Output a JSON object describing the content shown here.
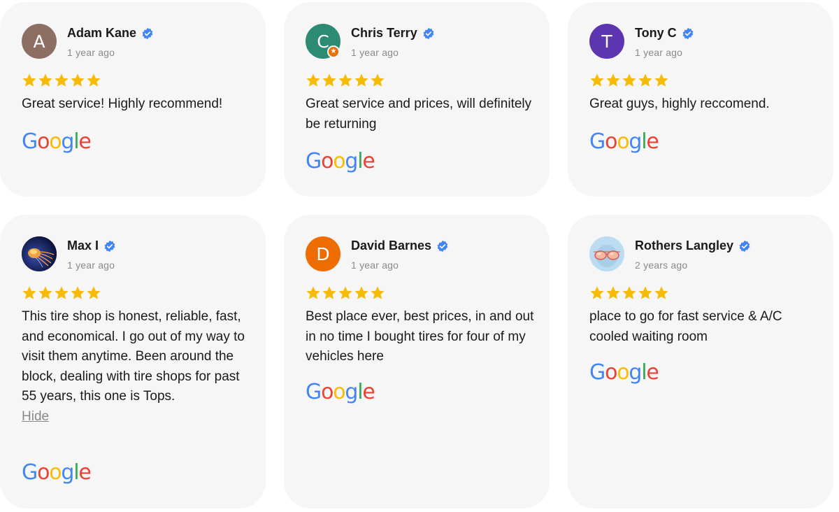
{
  "colors": {
    "card_bg": "#f6f6f6",
    "star": "#f6bb06",
    "verified": "#4285f4",
    "google_blue": "#4285f4",
    "google_red": "#ea4335",
    "google_yellow": "#fbbc05",
    "google_green": "#34a853"
  },
  "google_logo": {
    "letters": [
      "G",
      "o",
      "o",
      "g",
      "l",
      "e"
    ],
    "icon": "google-logo"
  },
  "reviews": [
    {
      "name": "Adam Kane",
      "avatar_letter": "A",
      "avatar_color": "#8d6e63",
      "verified": true,
      "date": "1 year ago",
      "rating": 5,
      "text": "Great service! Highly recommend!"
    },
    {
      "name": "Chris Terry",
      "avatar_letter": "C",
      "avatar_color": "#2e8b73",
      "avatar_badge": "local-guide-badge-icon",
      "verified": true,
      "date": "1 year ago",
      "rating": 5,
      "text": "Great service and prices, will definitely be returning"
    },
    {
      "name": "Tony C",
      "avatar_letter": "T",
      "avatar_color": "#5e35b1",
      "verified": true,
      "date": "1 year ago",
      "rating": 5,
      "text": "Great guys, highly reccomend."
    },
    {
      "name": "Max I",
      "avatar_letter": "",
      "avatar_image": "jellyfish-photo",
      "verified": true,
      "date": "1 year ago",
      "rating": 5,
      "text": "This tire shop is honest, reliable, fast, and economical. I go out of my way to visit them anytime. Been around the block, dealing with tire shops for past 55 years, this one is Tops.",
      "hide_label": "Hide"
    },
    {
      "name": "David Barnes",
      "avatar_letter": "D",
      "avatar_color": "#ef6c00",
      "verified": true,
      "date": "1 year ago",
      "rating": 5,
      "text": "Best place ever, best prices, in and out in no time I bought tires for four of my vehicles here"
    },
    {
      "name": "Rothers Langley",
      "avatar_letter": "",
      "avatar_image": "sunglasses-photo",
      "verified": true,
      "date": "2 years ago",
      "rating": 5,
      "text": "place to go for fast service & A/C cooled waiting room"
    }
  ]
}
